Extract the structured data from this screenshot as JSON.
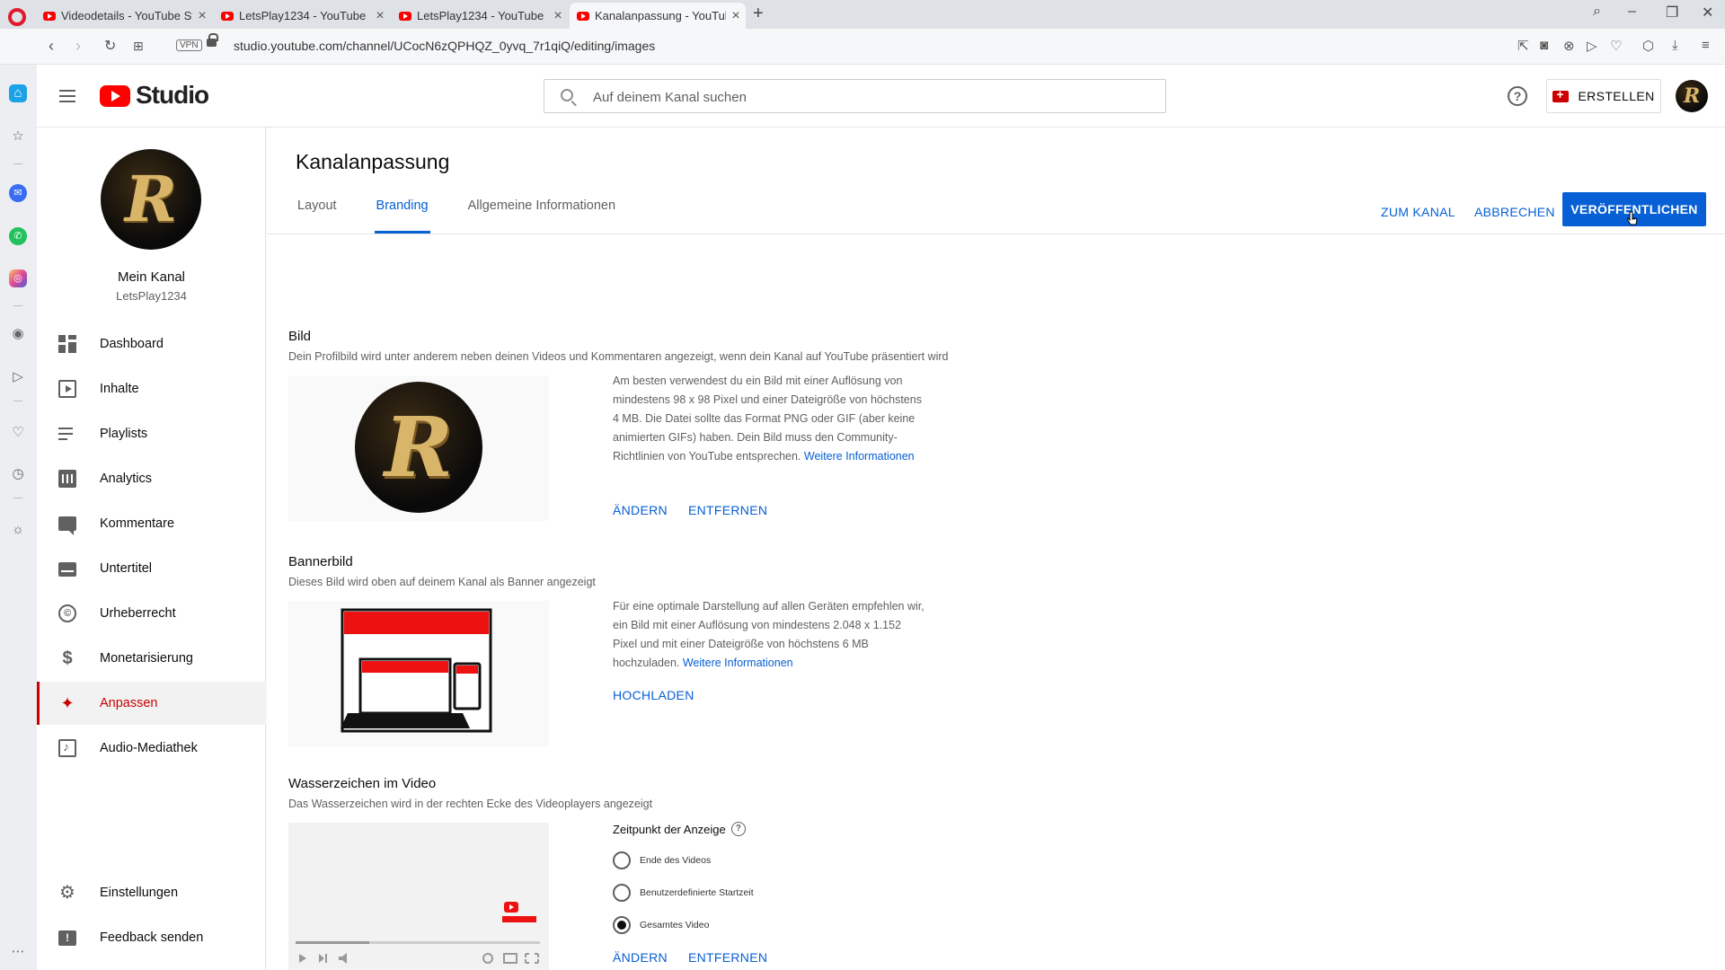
{
  "browser": {
    "tabs": [
      {
        "title": "Videodetails - YouTube St"
      },
      {
        "title": "LetsPlay1234 - YouTube"
      },
      {
        "title": "LetsPlay1234 - YouTube"
      },
      {
        "title": "Kanalanpassung - YouTube"
      }
    ],
    "url": "studio.youtube.com/channel/UCocN6zQPHQZ_0yvq_7r1qiQ/editing/images",
    "vpn_label": "VPN"
  },
  "topbar": {
    "logo_text": "Studio",
    "search_placeholder": "Auf deinem Kanal suchen",
    "help_label": "?",
    "create_label": "ERSTELLEN",
    "avatar_letter": "R"
  },
  "channel": {
    "avatar_letter": "R",
    "title": "Mein Kanal",
    "handle": "LetsPlay1234"
  },
  "nav": {
    "items": [
      {
        "label": "Dashboard",
        "icon": "dashboard-icon"
      },
      {
        "label": "Inhalte",
        "icon": "content-icon"
      },
      {
        "label": "Playlists",
        "icon": "playlist-icon"
      },
      {
        "label": "Analytics",
        "icon": "analytics-icon"
      },
      {
        "label": "Kommentare",
        "icon": "comments-icon"
      },
      {
        "label": "Untertitel",
        "icon": "subtitles-icon"
      },
      {
        "label": "Urheberrecht",
        "icon": "copyright-icon"
      },
      {
        "label": "Monetarisierung",
        "icon": "dollar-icon"
      },
      {
        "label": "Anpassen",
        "icon": "magic-wand-icon",
        "active": true
      },
      {
        "label": "Audio-Mediathek",
        "icon": "audio-library-icon"
      }
    ],
    "bottom": [
      {
        "label": "Einstellungen",
        "icon": "gear-icon"
      },
      {
        "label": "Feedback senden",
        "icon": "feedback-icon"
      }
    ]
  },
  "page": {
    "title": "Kanalanpassung",
    "tabs": [
      "Layout",
      "Branding",
      "Allgemeine Informationen"
    ],
    "active_tab": "Branding",
    "go_to_channel": "ZUM KANAL",
    "cancel": "ABBRECHEN",
    "publish": "VERÖFFENTLICHEN"
  },
  "sections": {
    "picture": {
      "title": "Bild",
      "description": "Dein Profilbild wird unter anderem neben deinen Videos und Kommentaren angezeigt, wenn dein Kanal auf YouTube präsentiert wird",
      "info": "Am besten verwendest du ein Bild mit einer Auflösung von mindestens 98 x 98 Pixel und einer Dateigröße von höchstens 4 MB. Die Datei sollte das Format PNG oder GIF (aber keine animierten GIFs) haben. Dein Bild muss den Community-Richtlinien von YouTube entsprechen.",
      "info_link": "Weitere Informationen",
      "change": "ÄNDERN",
      "remove": "ENTFERNEN"
    },
    "banner": {
      "title": "Bannerbild",
      "description": "Dieses Bild wird oben auf deinem Kanal als Banner angezeigt",
      "info": "Für eine optimale Darstellung auf allen Geräten empfehlen wir, ein Bild mit einer Auflösung von mindestens 2.048 x 1.152 Pixel und mit einer Dateigröße von höchstens 6 MB hochzuladen.",
      "info_link": "Weitere Informationen",
      "upload": "HOCHLADEN"
    },
    "watermark": {
      "title": "Wasserzeichen im Video",
      "description": "Das Wasserzeichen wird in der rechten Ecke des Videoplayers angezeigt",
      "timing_label": "Zeitpunkt der Anzeige",
      "options": [
        "Ende des Videos",
        "Benutzerdefinierte Startzeit",
        "Gesamtes Video"
      ],
      "selected": "Gesamtes Video",
      "change": "ÄNDERN",
      "remove": "ENTFERNEN"
    }
  },
  "colors": {
    "accent_blue": "#065fd4",
    "youtube_red": "#ff0000",
    "active_red": "#cc0000"
  }
}
